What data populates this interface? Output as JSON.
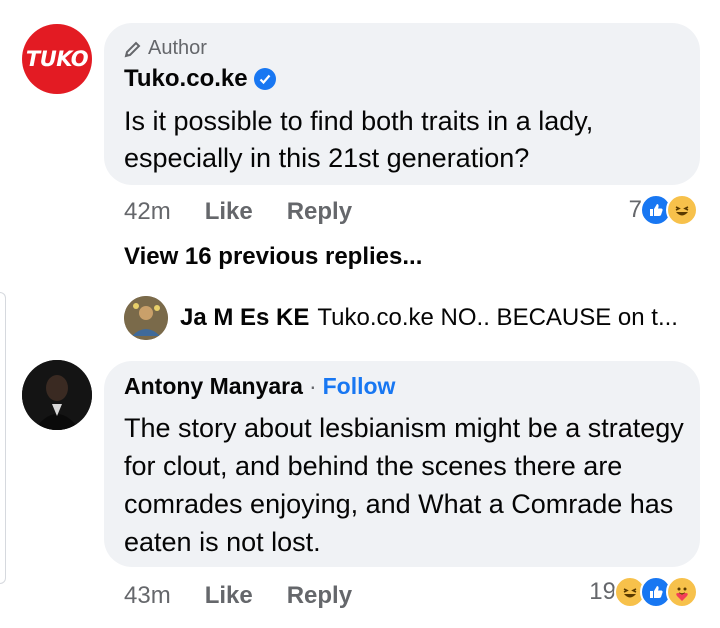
{
  "comment1": {
    "author_tag": "Author",
    "name": "Tuko.co.ke",
    "avatar_text": "TUKO",
    "text": "Is it possible to find both traits in a lady, especially in this 21st generation?",
    "timestamp": "42m",
    "like": "Like",
    "reply": "Reply",
    "reaction_count": "7",
    "reactions": [
      "like-icon",
      "haha-icon"
    ]
  },
  "view_previous": "View 16 previous replies...",
  "reply_preview": {
    "name": "Ja M Es KE",
    "text": "Tuko.co.ke NO.. BECAUSE on t..."
  },
  "comment2": {
    "name": "Antony Manyara",
    "separator": "·",
    "follow": "Follow",
    "text": "The story about lesbianism might be a strategy for clout, and behind the scenes there are comrades enjoying, and What a Comrade has eaten is not lost.",
    "timestamp": "43m",
    "like": "Like",
    "reply": "Reply",
    "reaction_count": "19",
    "reactions": [
      "haha-icon",
      "like-icon",
      "care-icon"
    ]
  },
  "colors": {
    "brand_red": "#e31b23",
    "link_blue": "#1877f2",
    "bubble_bg": "#f0f2f5",
    "meta_gray": "#65676b"
  }
}
